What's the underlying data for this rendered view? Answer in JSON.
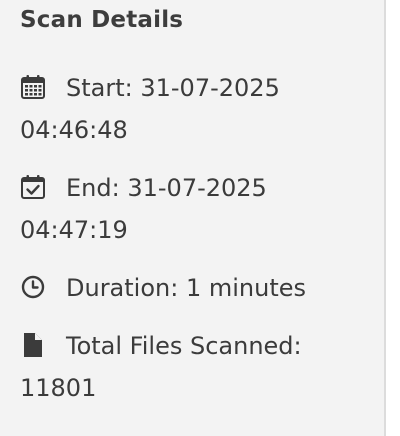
{
  "panel": {
    "title": "Scan Details",
    "items": [
      {
        "icon": "calendar-icon",
        "label": "Start:",
        "value": "31-07-2025 04:46:48"
      },
      {
        "icon": "calendar-check-icon",
        "label": "End:",
        "value": "31-07-2025 04:47:19"
      },
      {
        "icon": "clock-icon",
        "label": "Duration:",
        "value": "1 minutes"
      },
      {
        "icon": "file-icon",
        "label": "Total Files Scanned:",
        "value": "11801"
      }
    ]
  },
  "colors": {
    "panel_background": "#f3f3f3",
    "text": "#3b3b3b",
    "border": "#dcdcdc"
  }
}
